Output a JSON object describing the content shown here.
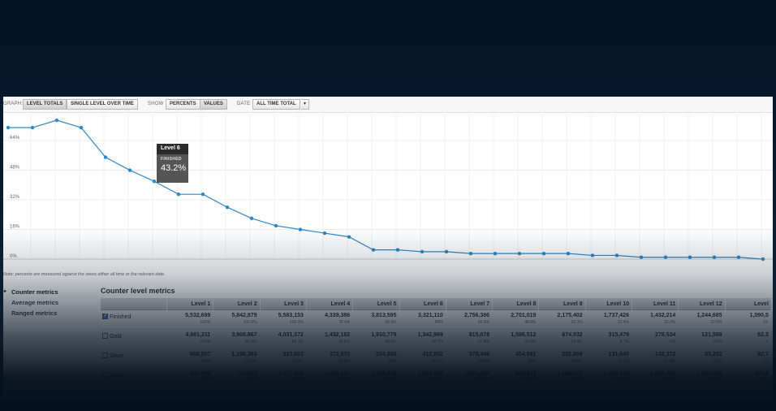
{
  "toolbar": {
    "graph_label": "GRAPH:",
    "graph_buttons": [
      "LEVEL TOTALS",
      "SINGLE LEVEL OVER TIME"
    ],
    "show_label": "SHOW",
    "show_buttons": [
      "PERCENTS",
      "VALUES"
    ],
    "date_label": "DATE",
    "date_value": "ALL TIME TOTAL",
    "dropdown_glyph": "▾"
  },
  "chart_data": {
    "type": "line",
    "y_ticks": [
      "64%",
      "48%",
      "32%",
      "16%",
      "0%"
    ],
    "ylim": [
      0,
      80
    ],
    "grid": true,
    "line_color": "#2e87c8",
    "x": [
      1,
      2,
      3,
      4,
      5,
      6,
      7,
      8,
      9,
      10,
      11,
      12,
      13,
      14,
      15,
      16,
      17,
      18,
      19,
      20,
      21,
      22,
      23,
      24,
      25,
      26,
      27,
      28,
      29,
      30,
      31,
      32
    ],
    "y": [
      71,
      71,
      75,
      71,
      55,
      48,
      42,
      35,
      35,
      28,
      22,
      18,
      16,
      14,
      12,
      5,
      5,
      4,
      4,
      3,
      3,
      3,
      3,
      3,
      2,
      2,
      1,
      1,
      1,
      1,
      1,
      0
    ]
  },
  "tooltip": {
    "title": "Level 6",
    "label": "FINISHED",
    "value": "43.2%"
  },
  "note": "Note: percents are measured against the views either all time or the relevant date.",
  "sidebar": {
    "items": [
      {
        "label": "Counter metrics",
        "active": true,
        "arrow": "▸"
      },
      {
        "label": "Average metrics",
        "active": false
      },
      {
        "label": "Ranged metrics",
        "active": false
      }
    ]
  },
  "table": {
    "title": "Counter level metrics",
    "columns": [
      "Level 1",
      "Level 2",
      "Level 3",
      "Level 4",
      "Level 5",
      "Level 6",
      "Level 7",
      "Level 8",
      "Level 9",
      "Level 10",
      "Level 11",
      "Level 12",
      "Level"
    ],
    "rows": [
      {
        "label": "Finished",
        "checked": true,
        "values": [
          "5,532,699",
          "5,842,879",
          "5,583,153",
          "4,339,386",
          "3,813,595",
          "3,321,110",
          "2,756,386",
          "2,701,019",
          "2,175,402",
          "1,737,426",
          "1,432,214",
          "1,244,685",
          "1,090,5"
        ],
        "pcts": [
          "100%",
          "105.6%",
          "100.9%",
          "78.4%",
          "68.9%",
          "60%",
          "49.8%",
          "48.8%",
          "39.3%",
          "31.4%",
          "25.9%",
          "22.5%",
          "19."
        ]
      },
      {
        "label": "Gold",
        "checked": false,
        "values": [
          "4,681,211",
          "3,900,867",
          "4,031,372",
          "1,432,182",
          "1,910,779",
          "1,342,969",
          "815,878",
          "1,586,512",
          "674,032",
          "315,479",
          "278,534",
          "121,598",
          "62,3"
        ],
        "pcts": [
          "100%",
          "83.3%",
          "86.1%",
          "30.6%",
          "40.8%",
          "28.7%",
          "17.4%",
          "33.9%",
          "14.4%",
          "6.7%",
          "6%",
          "2.6%",
          "1."
        ]
      },
      {
        "label": "Silver",
        "checked": false,
        "values": [
          "668,507",
          "1,198,363",
          "523,653",
          "372,970",
          "554,680",
          "412,802",
          "378,446",
          "454,691",
          "292,869",
          "131,645",
          "142,372",
          "35,282",
          "82,7"
        ],
        "pcts": [
          "100%",
          "179.3%",
          "78.3%",
          "55.8%",
          "83%",
          "61.7%",
          "56.6%",
          "68%",
          "43.8%",
          "19.7%",
          "21.3%",
          "5.3%",
          "12"
        ]
      },
      {
        "label": "Bronze",
        "checked": false,
        "values": [
          "524,799",
          "770,882",
          "1,017,803",
          "2,480,157",
          "1,344,236",
          "1,565,543",
          "1,554,284",
          "660,833",
          "1,196,573",
          "1,284,538",
          "1,006,453",
          "1,089,753",
          "950,8"
        ],
        "pcts": [
          "100%",
          "146.9%",
          "193.9%",
          "472.6%",
          "256.1%",
          "298.3%",
          "296.1%",
          "125.9%",
          "228%",
          "244.8%",
          "191.8%",
          "207.7%",
          "181"
        ]
      }
    ]
  }
}
